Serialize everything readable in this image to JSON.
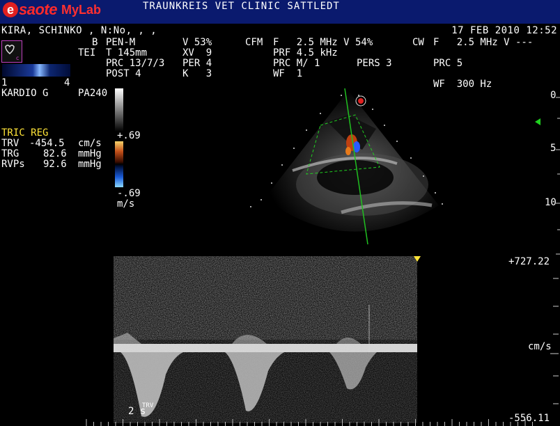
{
  "header": {
    "logo_brand": "saote",
    "logo_e": "e",
    "logo_product": "MyLab",
    "clinic": "TRAUNKREIS VET CLINIC SATTLEDT"
  },
  "patient": {
    "name_line": "KIRA, SCHINKO , N:No, , ,",
    "datetime": "17 FEB 2010 12:52"
  },
  "params": {
    "b_label": "B",
    "b_mode": "PEN-M",
    "tei": "TEI",
    "t_depth": "T 145mm",
    "prc_b": "PRC 13/7/3",
    "post": "POST 4",
    "v_b": "V 53%",
    "xv": "XV  9",
    "per": "PER 4",
    "k": "K   3",
    "cfm": "CFM",
    "cfm_f": "F   2.5 MHz V 54%",
    "prf": "PRF 4.5 kHz",
    "prc_cfm": "PRC M/ 1",
    "pers": "PERS 3",
    "wf_cfm": "WF  1",
    "cw": "CW",
    "cw_f": "F   2.5 MHz V ---",
    "prc_cw": "PRC 5",
    "wf_cw": "WF  300 Hz"
  },
  "left": {
    "index_1": "1",
    "index_4": "4",
    "probe": "KARDIO G",
    "probe_model": "PA240",
    "scale_pos": "+.69",
    "scale_neg": "-.69",
    "scale_unit": "m/s",
    "measure_title": "TRIC REG",
    "trv_label": "TRV",
    "trv_value": "-454.5",
    "trv_unit": "cm/s",
    "trg_label": "TRG",
    "trg_value": "82.6",
    "trg_unit": "mmHg",
    "rvps_label": "RVPs",
    "rvps_value": "92.6",
    "rvps_unit": "mmHg"
  },
  "depth_ruler": {
    "d0": "0",
    "d5": "5",
    "d10": "10"
  },
  "spectral": {
    "top_value": "+727.22",
    "unit": "cm/s",
    "bottom_value": "-556.11",
    "time_label": "2 s",
    "cursor_label": "TRV"
  },
  "colors": {
    "header_bg": "#0a1a6e",
    "accent_yellow": "#ffe438",
    "doppler_line": "#20c020",
    "logo_red": "#ff2a2a"
  }
}
